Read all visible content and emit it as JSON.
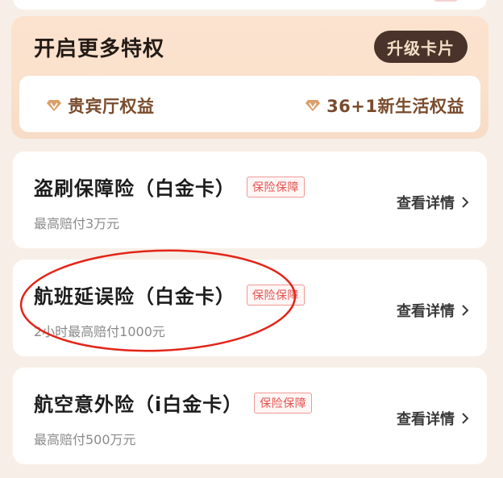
{
  "privilege": {
    "title": "开启更多特权",
    "upgrade_label": "升级卡片",
    "benefits": [
      {
        "label": "贵宾厅权益",
        "icon": "diamond-icon"
      },
      {
        "label": "36+1新生活权益",
        "icon": "diamond-icon"
      }
    ]
  },
  "insurances": [
    {
      "title": "盗刷保障险（白金卡）",
      "badge": "保险保障",
      "subtitle": "最高赔付3万元",
      "link": "查看详情"
    },
    {
      "title": "航班延误险（白金卡）",
      "badge": "保险保障",
      "subtitle": "2小时最高赔付1000元",
      "link": "查看详情"
    },
    {
      "title": "航空意外险（i白金卡）",
      "badge": "保险保障",
      "subtitle": "最高赔付500万元",
      "link": "查看详情"
    }
  ],
  "colors": {
    "accent_brown": "#4a332a",
    "badge_red": "#e2534f",
    "annotation_red": "#e32418",
    "gem": "#d9a06b"
  }
}
